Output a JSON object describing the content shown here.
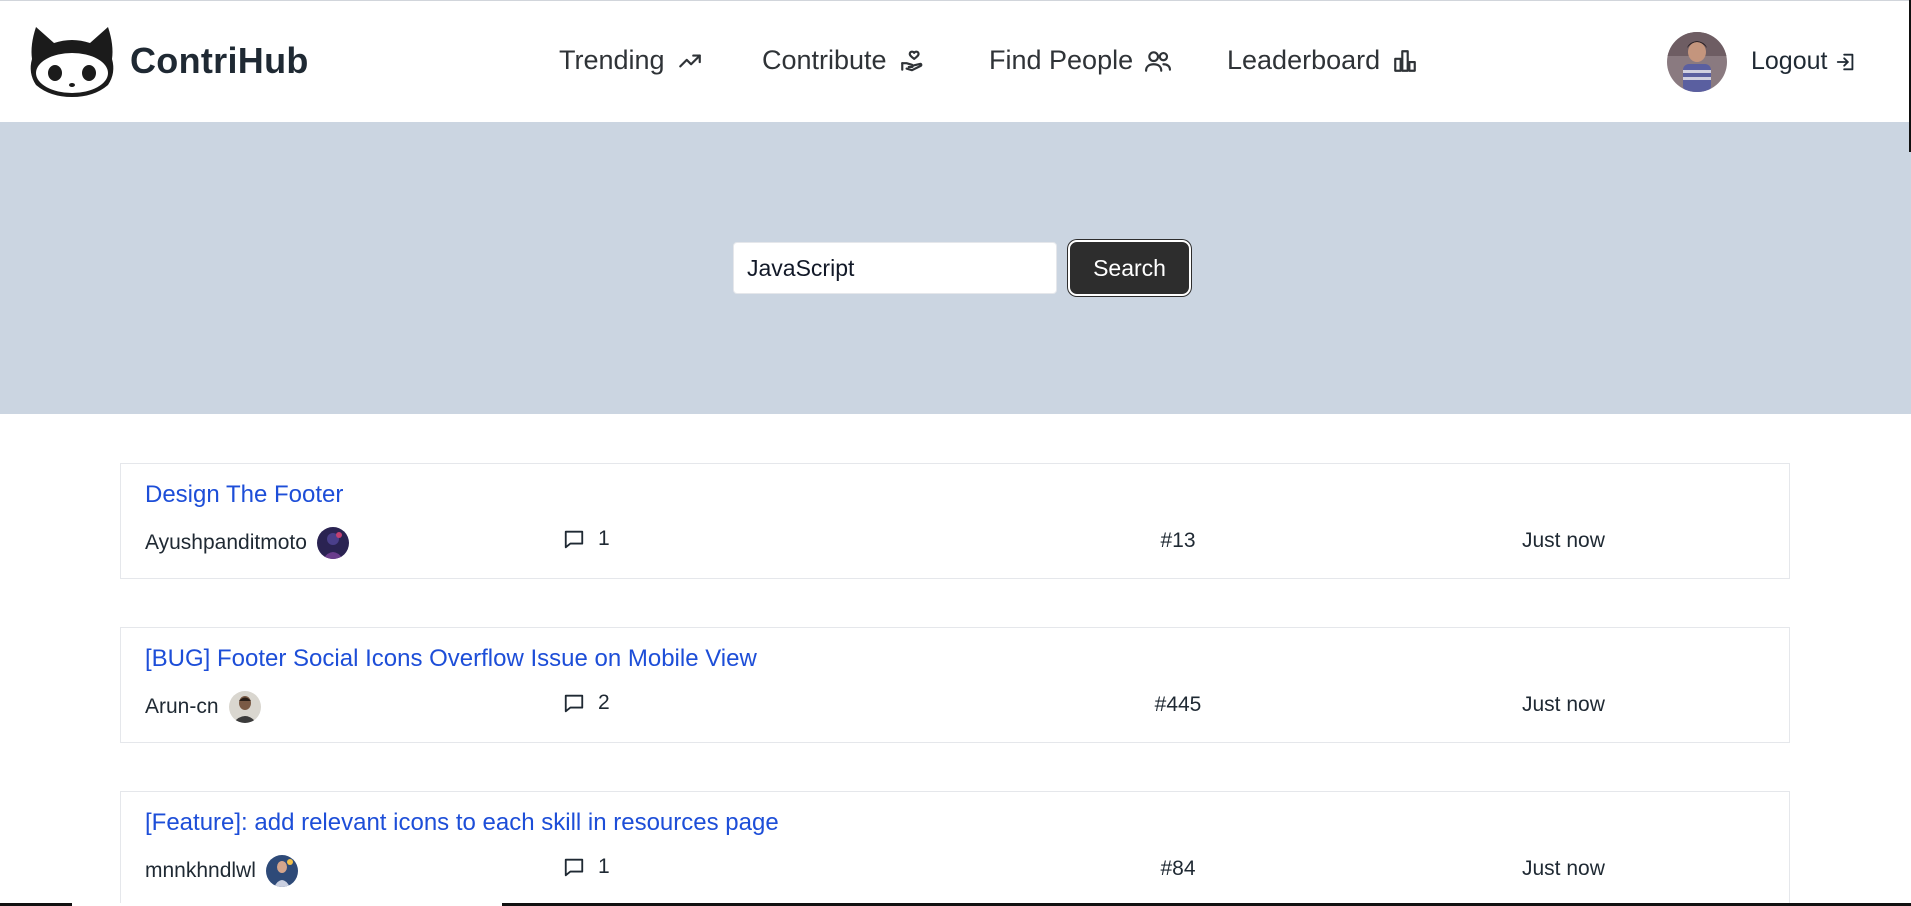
{
  "brand": {
    "name": "ContriHub",
    "logo_icon": "octocat-logo-icon"
  },
  "nav": [
    {
      "label": "Trending",
      "icon": "trending-up-icon"
    },
    {
      "label": "Contribute",
      "icon": "hand-heart-icon"
    },
    {
      "label": "Find People",
      "icon": "users-icon"
    },
    {
      "label": "Leaderboard",
      "icon": "bar-chart-icon"
    }
  ],
  "user": {
    "logout_label": "Logout",
    "logout_icon": "logout-icon"
  },
  "search": {
    "value": "JavaScript",
    "button_label": "Search"
  },
  "issues": [
    {
      "title": "Design The Footer",
      "author": "Ayushpanditmoto",
      "comments": "1",
      "number": "#13",
      "time": "Just now"
    },
    {
      "title": "[BUG] Footer Social Icons Overflow Issue on Mobile View",
      "author": "Arun-cn",
      "comments": "2",
      "number": "#445",
      "time": "Just now"
    },
    {
      "title": "[Feature]: add relevant icons to each skill in resources page",
      "author": "mnnkhndlwl",
      "comments": "1",
      "number": "#84",
      "time": "Just now"
    }
  ],
  "colors": {
    "hero_bg": "#cbd5e1",
    "link": "#1d4ed8",
    "button_bg": "#2d2d2d"
  }
}
